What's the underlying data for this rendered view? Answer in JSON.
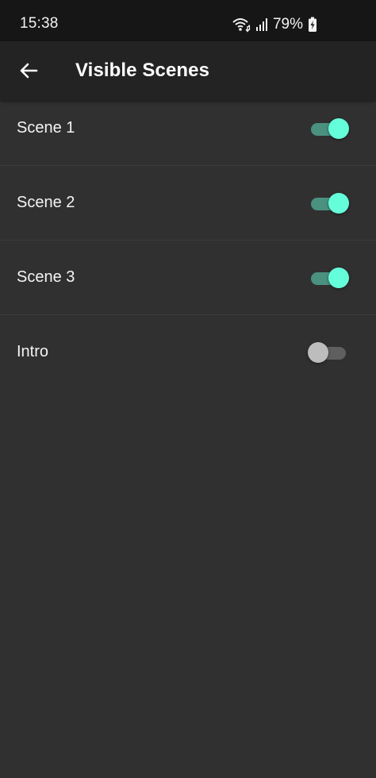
{
  "status_bar": {
    "time": "15:38",
    "battery_percent": "79%",
    "icons": [
      "wifi-icon",
      "signal-icon",
      "battery-charging-icon"
    ]
  },
  "app_bar": {
    "back_icon": "arrow-back-icon",
    "title": "Visible Scenes"
  },
  "scenes": [
    {
      "label": "Scene 1",
      "enabled": true
    },
    {
      "label": "Scene 2",
      "enabled": true
    },
    {
      "label": "Scene 3",
      "enabled": true
    },
    {
      "label": "Intro",
      "enabled": false
    }
  ],
  "colors": {
    "background": "#303030",
    "app_bar": "#232323",
    "status_bar": "#161616",
    "accent": "#64ffda",
    "accent_track": "#4a9180",
    "off_thumb": "#bdbdbd",
    "off_track": "#5f5f5f"
  }
}
